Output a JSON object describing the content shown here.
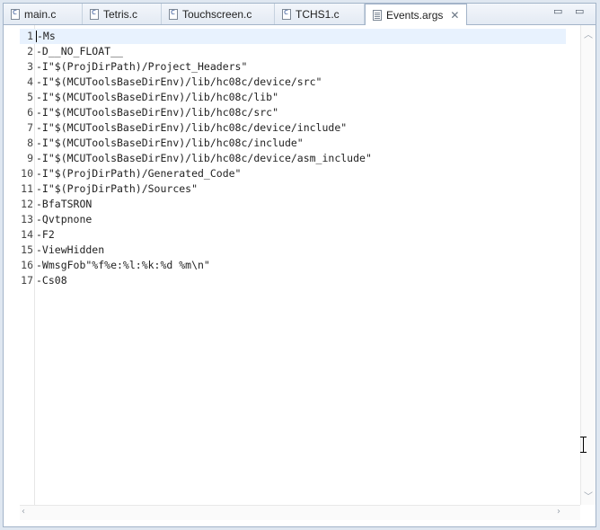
{
  "tabs": [
    {
      "label": "main.c",
      "icon": "c-file-icon"
    },
    {
      "label": "Tetris.c",
      "icon": "c-file-icon"
    },
    {
      "label": "Touchscreen.c",
      "icon": "c-file-icon"
    },
    {
      "label": "TCHS1.c",
      "icon": "c-file-icon"
    },
    {
      "label": "Events.args",
      "icon": "text-file-icon",
      "active": true
    }
  ],
  "window_controls": {
    "minimize": "▭",
    "maximize": "▭"
  },
  "editor": {
    "lines": [
      {
        "num": "1",
        "text": "-Ms"
      },
      {
        "num": "2",
        "text": "-D__NO_FLOAT__"
      },
      {
        "num": "3",
        "text": "-I\"$(ProjDirPath)/Project_Headers\""
      },
      {
        "num": "4",
        "text": "-I\"$(MCUToolsBaseDirEnv)/lib/hc08c/device/src\""
      },
      {
        "num": "5",
        "text": "-I\"$(MCUToolsBaseDirEnv)/lib/hc08c/lib\""
      },
      {
        "num": "6",
        "text": "-I\"$(MCUToolsBaseDirEnv)/lib/hc08c/src\""
      },
      {
        "num": "7",
        "text": "-I\"$(MCUToolsBaseDirEnv)/lib/hc08c/device/include\""
      },
      {
        "num": "8",
        "text": "-I\"$(MCUToolsBaseDirEnv)/lib/hc08c/include\""
      },
      {
        "num": "9",
        "text": "-I\"$(MCUToolsBaseDirEnv)/lib/hc08c/device/asm_include\""
      },
      {
        "num": "10",
        "text": "-I\"$(ProjDirPath)/Generated_Code\""
      },
      {
        "num": "11",
        "text": "-I\"$(ProjDirPath)/Sources\""
      },
      {
        "num": "12",
        "text": "-BfaTSRON"
      },
      {
        "num": "13",
        "text": "-Qvtpnone"
      },
      {
        "num": "14",
        "text": "-F2"
      },
      {
        "num": "15",
        "text": "-ViewHidden"
      },
      {
        "num": "16",
        "text": "-WmsgFob\"%f%e:%l:%k:%d %m\\n\""
      },
      {
        "num": "17",
        "text": "-Cs08"
      }
    ]
  },
  "colors": {
    "current_line": "#e8f2fe",
    "tab_border": "#a3b4c9"
  }
}
